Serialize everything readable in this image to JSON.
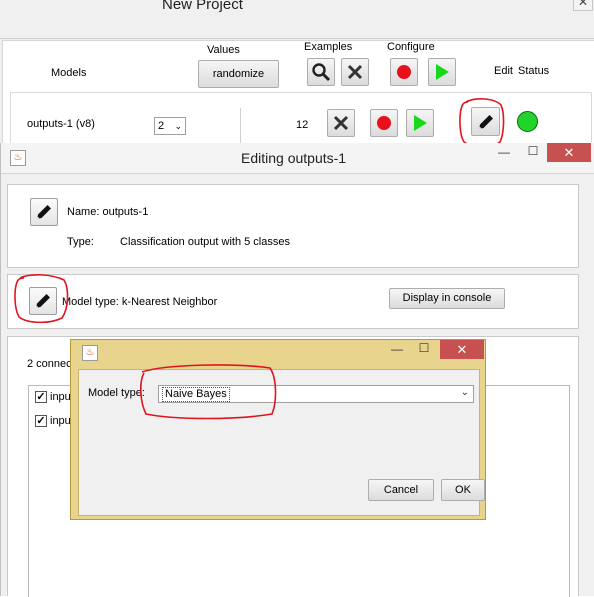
{
  "main_window": {
    "title": "New Project",
    "headers": {
      "values": "Values",
      "examples": "Examples",
      "configure": "Configure",
      "models": "Models",
      "edit": "Edit",
      "status": "Status"
    },
    "randomize_label": "randomize",
    "model_row": {
      "name": "outputs-1 (v8)",
      "version": "2",
      "examples_count": "12",
      "status_color": "#21d42a"
    }
  },
  "edit_dialog": {
    "title": "Editing outputs-1",
    "name_line": "Name: outputs-1",
    "type_label": "Type:",
    "type_value": "Classification output with 5 classes",
    "model_type_line": "Model type:  k-Nearest Neighbor",
    "display_console_label": "Display in console",
    "connections_text": "2 connec",
    "inputs": [
      {
        "label": "input",
        "checked": true
      },
      {
        "label": "input",
        "checked": true
      }
    ]
  },
  "model_type_dialog": {
    "field_label": "Model type:",
    "selected": "Naive Bayes",
    "cancel_label": "Cancel",
    "ok_label": "OK"
  },
  "colors": {
    "accent_record": "#e8101a",
    "accent_run": "#17d81b",
    "annotation": "#e0141e",
    "close_button": "#c75050",
    "dialog_frame": "#e9d48e"
  },
  "icons": [
    "close-icon",
    "search-icon",
    "clear-icon",
    "record-icon",
    "run-icon",
    "pencil-icon",
    "app-icon",
    "minimize-icon",
    "maximize-icon",
    "chevron-down-icon",
    "checkbox-icon"
  ]
}
